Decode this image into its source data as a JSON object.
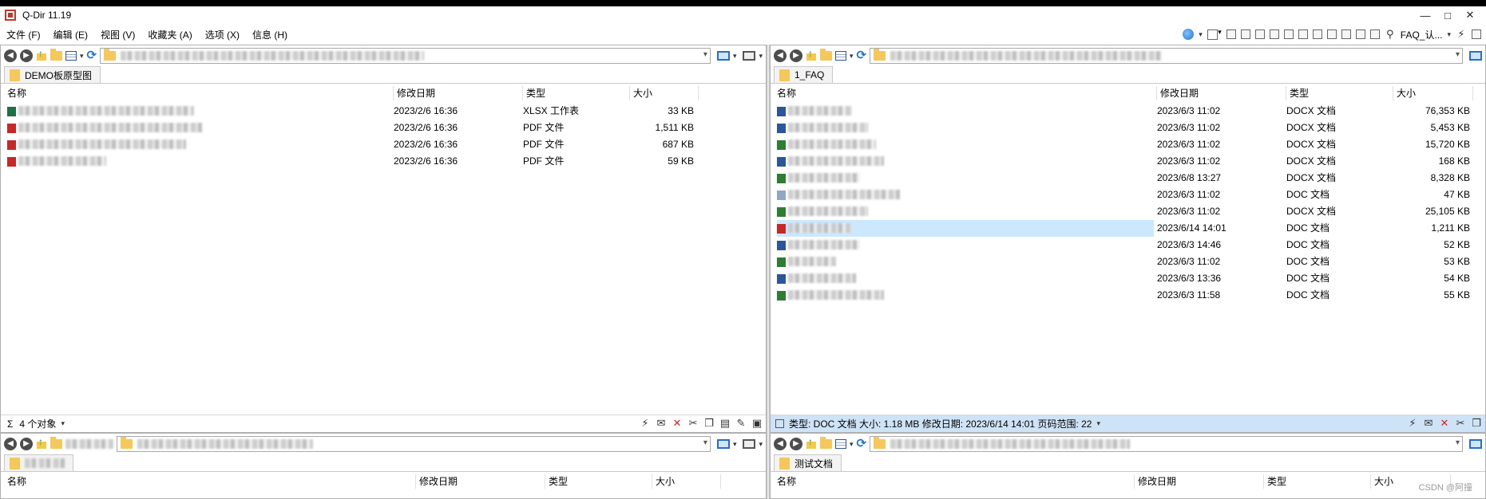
{
  "window": {
    "title": "Q-Dir 11.19",
    "controls": [
      "—",
      "□",
      "✕"
    ]
  },
  "menu": [
    "文件 (F)",
    "编辑 (E)",
    "视图 (V)",
    "收藏夹 (A)",
    "选项 (X)",
    "信息 (H)"
  ],
  "main_toolbar": {
    "faq_label": "FAQ_认..."
  },
  "left_top": {
    "tab": "DEMO板原型图",
    "columns": {
      "name": "名称",
      "date": "修改日期",
      "type": "类型",
      "size": "大小"
    },
    "files": [
      {
        "date": "2023/2/6 16:36",
        "type": "XLSX 工作表",
        "size": "33 KB",
        "icon_color": "#1e7145"
      },
      {
        "date": "2023/2/6 16:36",
        "type": "PDF 文件",
        "size": "1,511 KB",
        "icon_color": "#c62828"
      },
      {
        "date": "2023/2/6 16:36",
        "type": "PDF 文件",
        "size": "687 KB",
        "icon_color": "#c62828"
      },
      {
        "date": "2023/2/6 16:36",
        "type": "PDF 文件",
        "size": "59 KB",
        "icon_color": "#c62828"
      }
    ],
    "status": "4 个对象"
  },
  "right_top": {
    "tab": "1_FAQ",
    "columns": {
      "name": "名称",
      "date": "修改日期",
      "type": "类型",
      "size": "大小"
    },
    "files": [
      {
        "date": "2023/6/3 11:02",
        "type": "DOCX 文档",
        "size": "76,353 KB",
        "icon_color": "#2b579a"
      },
      {
        "date": "2023/6/3 11:02",
        "type": "DOCX 文档",
        "size": "5,453 KB",
        "icon_color": "#2b579a"
      },
      {
        "date": "2023/6/3 11:02",
        "type": "DOCX 文档",
        "size": "15,720 KB",
        "icon_color": "#2e7d32"
      },
      {
        "date": "2023/6/3 11:02",
        "type": "DOCX 文档",
        "size": "168 KB",
        "icon_color": "#2b579a"
      },
      {
        "date": "2023/6/8 13:27",
        "type": "DOCX 文档",
        "size": "8,328 KB",
        "icon_color": "#2e7d32"
      },
      {
        "date": "2023/6/3 11:02",
        "type": "DOC 文档",
        "size": "47 KB",
        "icon_color": "#8fa7c4"
      },
      {
        "date": "2023/6/3 11:02",
        "type": "DOCX 文档",
        "size": "25,105 KB",
        "icon_color": "#2e7d32"
      },
      {
        "date": "2023/6/14 14:01",
        "type": "DOC 文档",
        "size": "1,211 KB",
        "icon_color": "#c62828",
        "selected": true
      },
      {
        "date": "2023/6/3 14:46",
        "type": "DOC 文档",
        "size": "52 KB",
        "icon_color": "#2b579a"
      },
      {
        "date": "2023/6/3 11:02",
        "type": "DOC 文档",
        "size": "53 KB",
        "icon_color": "#2e7d32"
      },
      {
        "date": "2023/6/3 13:36",
        "type": "DOC 文档",
        "size": "54 KB",
        "icon_color": "#2b579a"
      },
      {
        "date": "2023/6/3 11:58",
        "type": "DOC 文档",
        "size": "55 KB",
        "icon_color": "#2e7d32"
      }
    ],
    "status": "类型: DOC 文档 大小: 1.18 MB 修改日期: 2023/6/14 14:01 页码范围: 22"
  },
  "left_bottom": {
    "columns": {
      "name": "名称",
      "date": "修改日期",
      "type": "类型",
      "size": "大小"
    }
  },
  "right_bottom": {
    "tab": "测试文档",
    "columns": {
      "name": "名称",
      "date": "修改日期",
      "type": "类型",
      "size": "大小"
    }
  },
  "watermark": "CSDN @阿撞"
}
